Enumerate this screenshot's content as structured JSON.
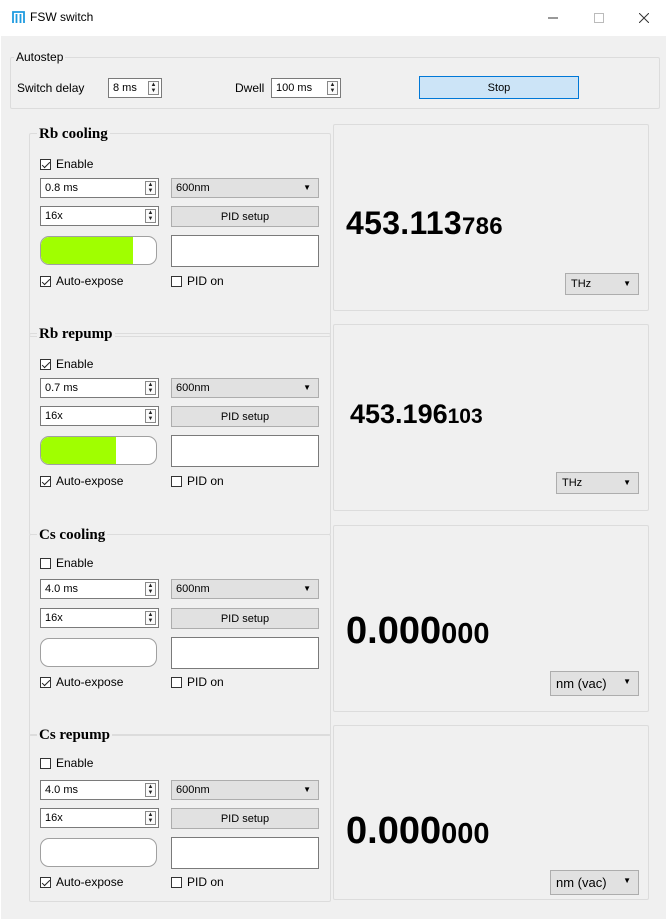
{
  "window": {
    "title": "FSW switch"
  },
  "autostep": {
    "title": "Autostep",
    "switch_delay_label": "Switch delay",
    "switch_delay_value": "8 ms",
    "dwell_label": "Dwell",
    "dwell_value": "100 ms",
    "stop_label": "Stop"
  },
  "channels": [
    {
      "name": "Rb cooling",
      "enable_label": "Enable",
      "enabled": true,
      "exposure": "0.8 ms",
      "range": "600nm",
      "gain": "16x",
      "pid_setup_label": "PID setup",
      "level_fraction": 0.8,
      "auto_expose_label": "Auto-expose",
      "auto_expose": true,
      "pid_on_label": "PID on",
      "pid_on": false,
      "freq_main": "453.113",
      "freq_sub": "786",
      "unit": "THz"
    },
    {
      "name": "Rb repump",
      "enable_label": "Enable",
      "enabled": true,
      "exposure": "0.7 ms",
      "range": "600nm",
      "gain": "16x",
      "pid_setup_label": "PID setup",
      "level_fraction": 0.65,
      "auto_expose_label": "Auto-expose",
      "auto_expose": true,
      "pid_on_label": "PID on",
      "pid_on": false,
      "freq_main": "453.196",
      "freq_sub": "103",
      "unit": "THz"
    },
    {
      "name": "Cs cooling",
      "enable_label": "Enable",
      "enabled": false,
      "exposure": "4.0 ms",
      "range": "600nm",
      "gain": "16x",
      "pid_setup_label": "PID setup",
      "level_fraction": 0,
      "auto_expose_label": "Auto-expose",
      "auto_expose": true,
      "pid_on_label": "PID on",
      "pid_on": false,
      "freq_main": "0.000",
      "freq_sub": "000",
      "unit": "nm (vac)"
    },
    {
      "name": "Cs repump",
      "enable_label": "Enable",
      "enabled": false,
      "exposure": "4.0 ms",
      "range": "600nm",
      "gain": "16x",
      "pid_setup_label": "PID setup",
      "level_fraction": 0,
      "auto_expose_label": "Auto-expose",
      "auto_expose": true,
      "pid_on_label": "PID on",
      "pid_on": false,
      "freq_main": "0.000",
      "freq_sub": "000",
      "unit": "nm (vac)"
    }
  ],
  "colors": {
    "level_fill": "#a0ff00",
    "app_icon": "#1e9be0",
    "stop_button": "#cce4f7"
  }
}
